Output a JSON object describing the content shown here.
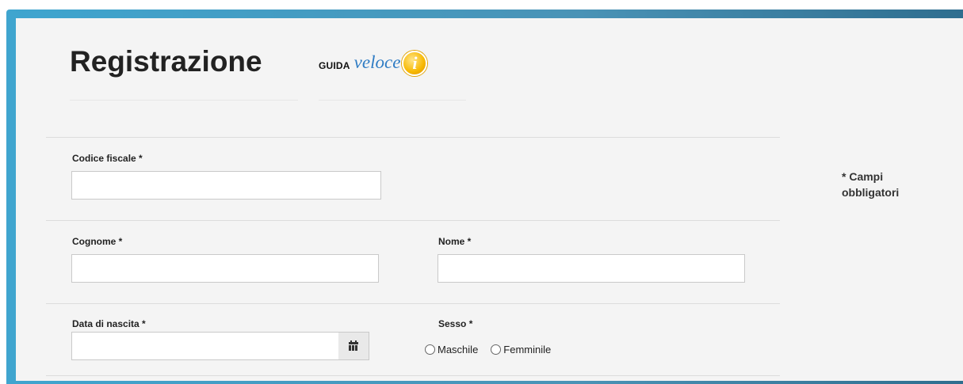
{
  "page": {
    "title": "Registrazione",
    "guide": {
      "prefix": "GUIDA",
      "highlight": "veloce",
      "icon": "info-icon",
      "icon_glyph": "i"
    },
    "required_note": "* Campi obbligatori"
  },
  "form": {
    "codice_fiscale": {
      "label": "Codice fiscale *",
      "value": ""
    },
    "cognome": {
      "label": "Cognome *",
      "value": ""
    },
    "nome": {
      "label": "Nome *",
      "value": ""
    },
    "data_nascita": {
      "label": "Data di nascita *",
      "value": "",
      "button_icon": "calendar-icon"
    },
    "sesso": {
      "label": "Sesso *",
      "options": [
        "Maschile",
        "Femminile"
      ],
      "selected": ""
    }
  },
  "colors": {
    "frame_accent": "#3fa5cf",
    "panel_bg": "#f4f4f4",
    "veloce_blue": "#2f7cc4",
    "info_yellow": "#f7b800"
  }
}
